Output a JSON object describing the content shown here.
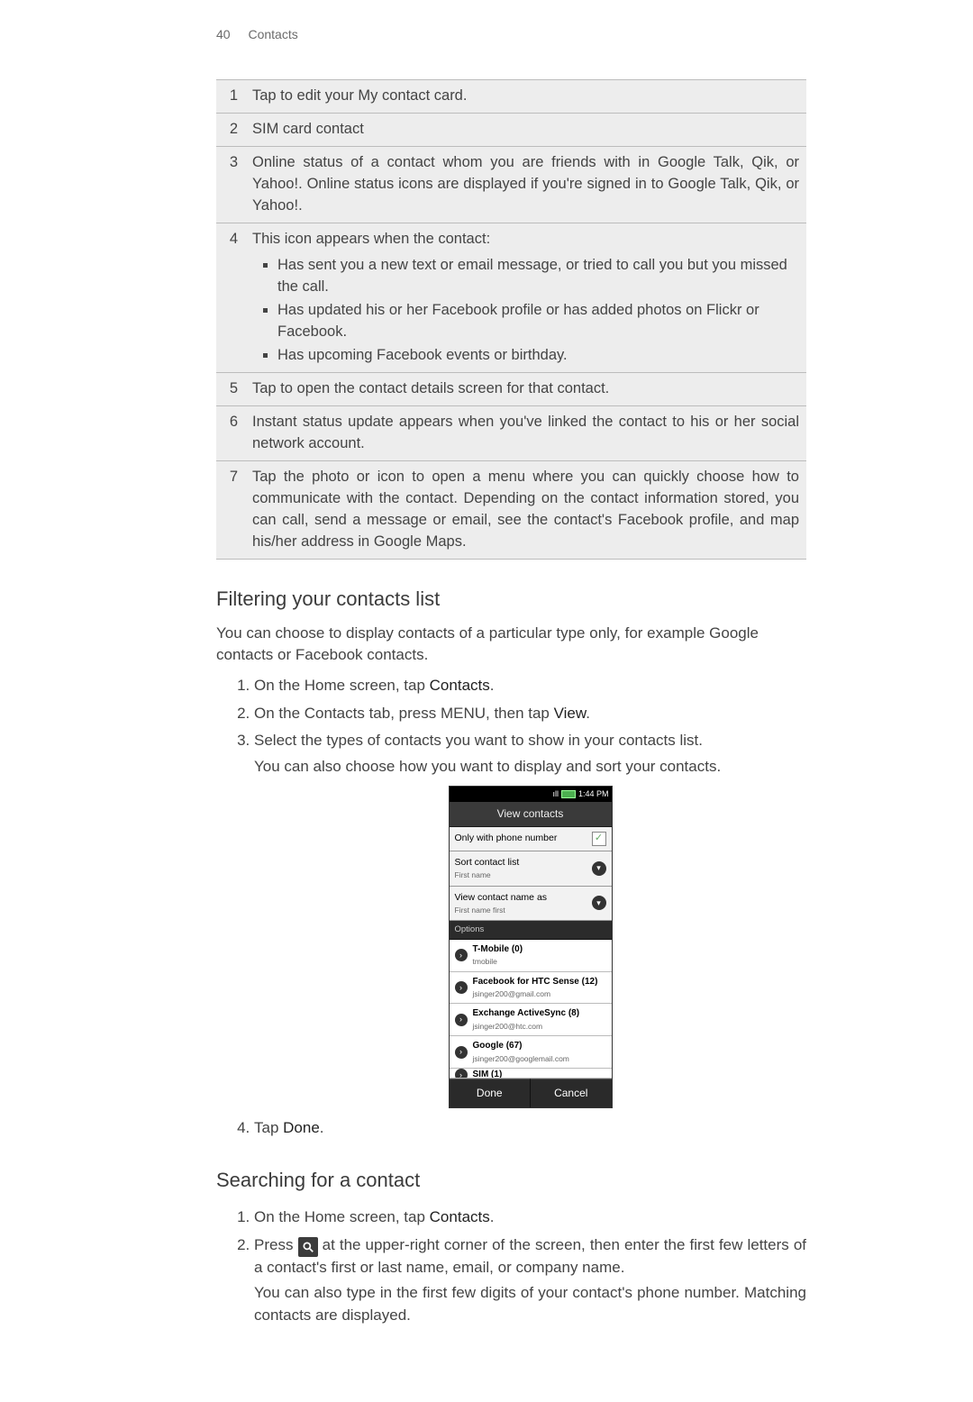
{
  "header": {
    "page_number": "40",
    "section": "Contacts"
  },
  "table": {
    "rows": [
      {
        "num": "1",
        "text": "Tap to edit your My contact card."
      },
      {
        "num": "2",
        "text": "SIM card contact"
      },
      {
        "num": "3",
        "text": "Online status of a contact whom you are friends with in Google Talk, Qik, or Yahoo!. Online status icons are displayed if you're signed in to Google Talk, Qik, or Yahoo!."
      },
      {
        "num": "4",
        "text": "This icon appears when the contact:",
        "bullets": [
          "Has sent you a new text or email message, or tried to call you but you missed the call.",
          "Has updated his or her Facebook profile or has added photos on Flickr or Facebook.",
          "Has upcoming Facebook events or birthday."
        ]
      },
      {
        "num": "5",
        "text": "Tap to open the contact details screen for that contact."
      },
      {
        "num": "6",
        "text": "Instant status update appears when you've linked the contact to his or her social network account."
      },
      {
        "num": "7",
        "text": "Tap the photo or icon to open a menu where you can quickly choose how to communicate with the contact. Depending on the contact information stored, you can call, send a message or email, see the contact's Facebook profile, and map his/her address in Google Maps."
      }
    ]
  },
  "filtering": {
    "heading": "Filtering your contacts list",
    "intro": "You can choose to display contacts of a particular type only, for example Google contacts or Facebook contacts.",
    "steps": {
      "s1a": "On the Home screen, tap ",
      "s1b": "Contacts",
      "s1c": ".",
      "s2a": "On the Contacts tab, press MENU, then tap ",
      "s2b": "View",
      "s2c": ".",
      "s3": "Select the types of contacts you want to show in your contacts list.",
      "s3sub": "You can also choose how you want to display and sort your contacts.",
      "s4a": "Tap ",
      "s4b": "Done",
      "s4c": "."
    }
  },
  "screenshot": {
    "time": "1:44 PM",
    "title": "View contacts",
    "rows": {
      "only_phone": "Only with phone number",
      "sort": {
        "label": "Sort contact list",
        "value": "First name"
      },
      "name_as": {
        "label": "View contact name as",
        "value": "First name first"
      }
    },
    "options_header": "Options",
    "options": [
      {
        "title": "T-Mobile (0)",
        "sub": "tmobile"
      },
      {
        "title": "Facebook for HTC Sense (12)",
        "sub": "jsinger200@gmail.com"
      },
      {
        "title": "Exchange ActiveSync (8)",
        "sub": "jsinger200@htc.com"
      },
      {
        "title": "Google (67)",
        "sub": "jsinger200@googlemail.com"
      },
      {
        "title": "SIM (1)",
        "sub": ""
      }
    ],
    "done": "Done",
    "cancel": "Cancel"
  },
  "searching": {
    "heading": "Searching for a contact",
    "s1a": "On the Home screen, tap ",
    "s1b": "Contacts",
    "s1c": ".",
    "s2a": "Press ",
    "s2b": " at the upper-right corner of the screen, then enter the first few letters of a contact's first or last name, email, or company name.",
    "s2sub": "You can also type in the first few digits of your contact's phone number. Matching contacts are displayed."
  }
}
